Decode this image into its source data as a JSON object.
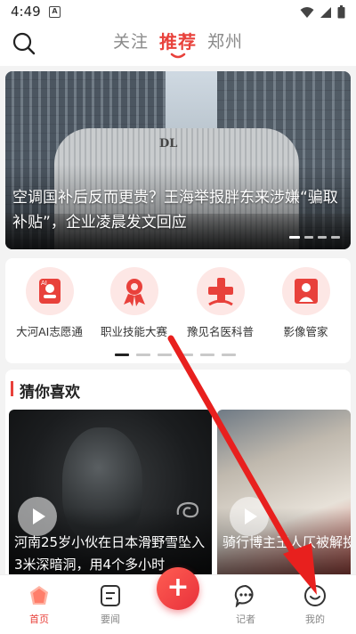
{
  "status_bar": {
    "time": "4:49",
    "notification_badge": "A"
  },
  "top_nav": {
    "search_icon": "search-icon",
    "tabs": [
      {
        "label": "关注",
        "active": false
      },
      {
        "label": "推荐",
        "active": true
      },
      {
        "label": "郑州",
        "active": false
      }
    ]
  },
  "banner": {
    "title": "空调国补后反而更贵？王海举报胖东来涉嫌“骗取补贴”，企业凌晨发文回应",
    "building_sign": "DL",
    "dot_count": 4
  },
  "services": {
    "items": [
      {
        "label": "大河AI志愿通",
        "icon": "ai-volunteer-icon"
      },
      {
        "label": "职业技能大赛",
        "icon": "skills-contest-icon"
      },
      {
        "label": "豫见名医科普",
        "icon": "medical-cross-icon"
      },
      {
        "label": "影像管家",
        "icon": "photo-butler-icon"
      }
    ],
    "pages": 6,
    "active_page": 0
  },
  "guess": {
    "title": "猜你喜欢",
    "cards": [
      {
        "title": "河南25岁小伙在日本滑野雪坠入3米深暗洞，用4个多小时",
        "type": "video"
      },
      {
        "title": "骑行博主王人仄被解投送食物，本人",
        "type": "video"
      }
    ]
  },
  "bottom_nav": {
    "items": [
      {
        "label": "首页",
        "icon": "home-icon",
        "active": true
      },
      {
        "label": "要闻",
        "icon": "news-icon",
        "active": false
      },
      {
        "label": "记者",
        "icon": "chat-icon",
        "active": false
      },
      {
        "label": "我的",
        "icon": "profile-icon",
        "active": false
      }
    ],
    "publish_label": "+"
  },
  "colors": {
    "accent": "#e8413b",
    "annotation_arrow": "#e8201e"
  }
}
